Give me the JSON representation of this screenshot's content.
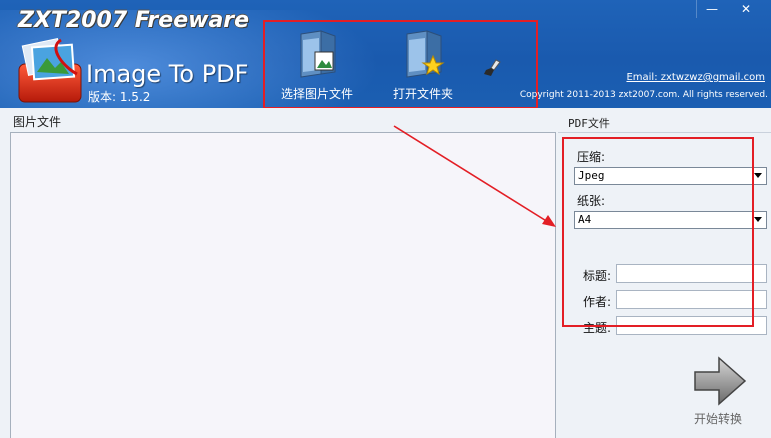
{
  "header": {
    "brand": "ZXT2007 Freeware",
    "product": "Image To PDF",
    "version": "版本: 1.5.2",
    "email": "Email: zxtwzwz@gmail.com",
    "copyright": "Copyright 2011-2013 zxt2007.com. All rights reserved."
  },
  "toolbar": {
    "select_images": "选择图片文件",
    "open_folder": "打开文件夹",
    "clear_icon": "broom-icon"
  },
  "window": {
    "minimize": "—",
    "close": "✕"
  },
  "left_panel": {
    "title": "图片文件"
  },
  "right_panel": {
    "title": "PDF文件",
    "compress_label": "压缩:",
    "compress_value": "Jpeg",
    "paper_label": "纸张:",
    "paper_value": "A4",
    "title_label": "标题:",
    "author_label": "作者:",
    "subject_label": "主题:",
    "title_value": "",
    "author_value": "",
    "subject_value": ""
  },
  "start": {
    "label": "开始转换"
  },
  "colors": {
    "header_blue": "#1d5fb3",
    "annotation_red": "#e31e25",
    "panel_bg": "#f6f5fa"
  }
}
